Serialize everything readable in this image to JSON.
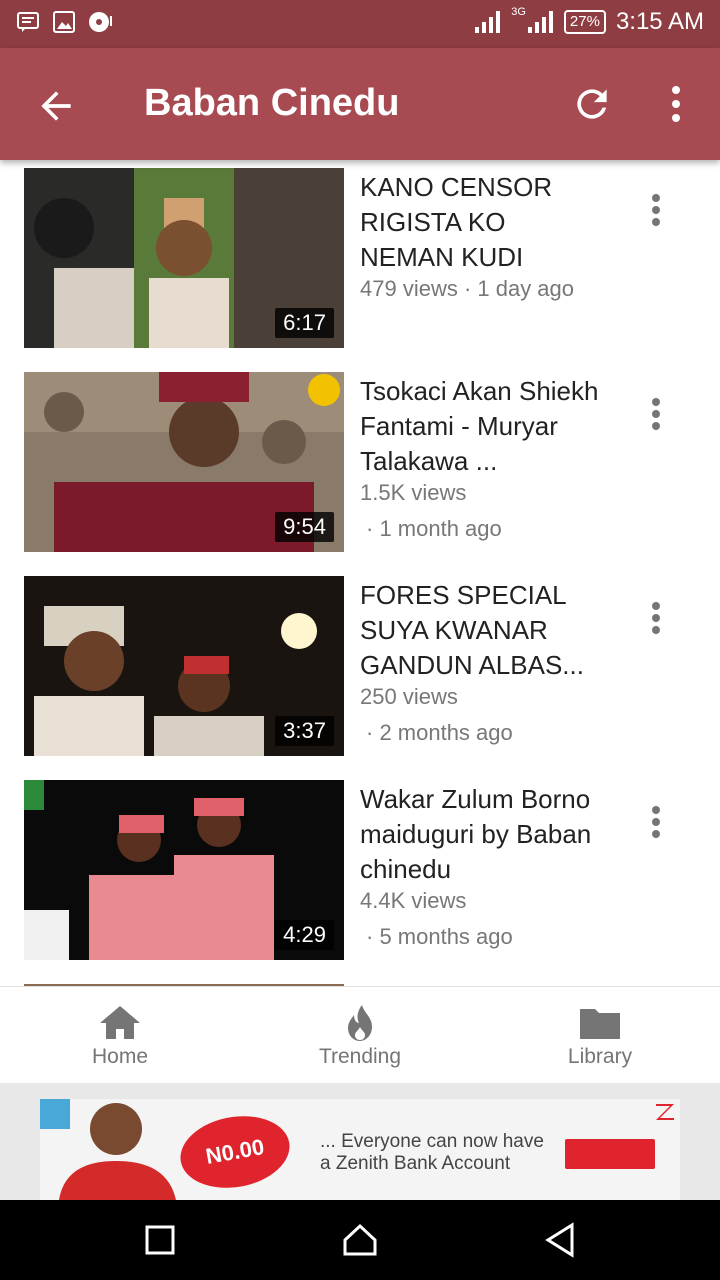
{
  "status_bar": {
    "network": "3G",
    "battery": "27%",
    "time": "3:15 AM"
  },
  "toolbar": {
    "title": "Baban Cinedu"
  },
  "videos": [
    {
      "title": "KANO CENSOR RIGISTA KO NEMAN KUDI",
      "meta": "479 views · 1 day ago",
      "date": "",
      "duration": "6:17"
    },
    {
      "title": "Tsokaci Akan Shiekh Fantami - Muryar Talakawa ...",
      "meta": "1.5K views",
      "date": "· 1 month ago",
      "duration": "9:54"
    },
    {
      "title": "FORES SPECIAL SUYA KWANAR GANDUN ALBAS...",
      "meta": "250 views",
      "date": "· 2 months ago",
      "duration": "3:37"
    },
    {
      "title": "Wakar Zulum Borno maiduguri by Baban chinedu",
      "meta": "4.4K views",
      "date": "· 5 months ago",
      "duration": "4:29"
    }
  ],
  "bottom_nav": [
    {
      "label": "Home",
      "icon": "home-icon"
    },
    {
      "label": "Trending",
      "icon": "flame-icon"
    },
    {
      "label": "Library",
      "icon": "folder-icon"
    }
  ],
  "ad": {
    "amount": "N0.00",
    "text_line1": "... Everyone can now have",
    "text_line2": "a Zenith Bank Account"
  },
  "colors": {
    "status_bar": "#8e3d42",
    "toolbar": "#a84a52",
    "ad_red": "#e0242d"
  }
}
